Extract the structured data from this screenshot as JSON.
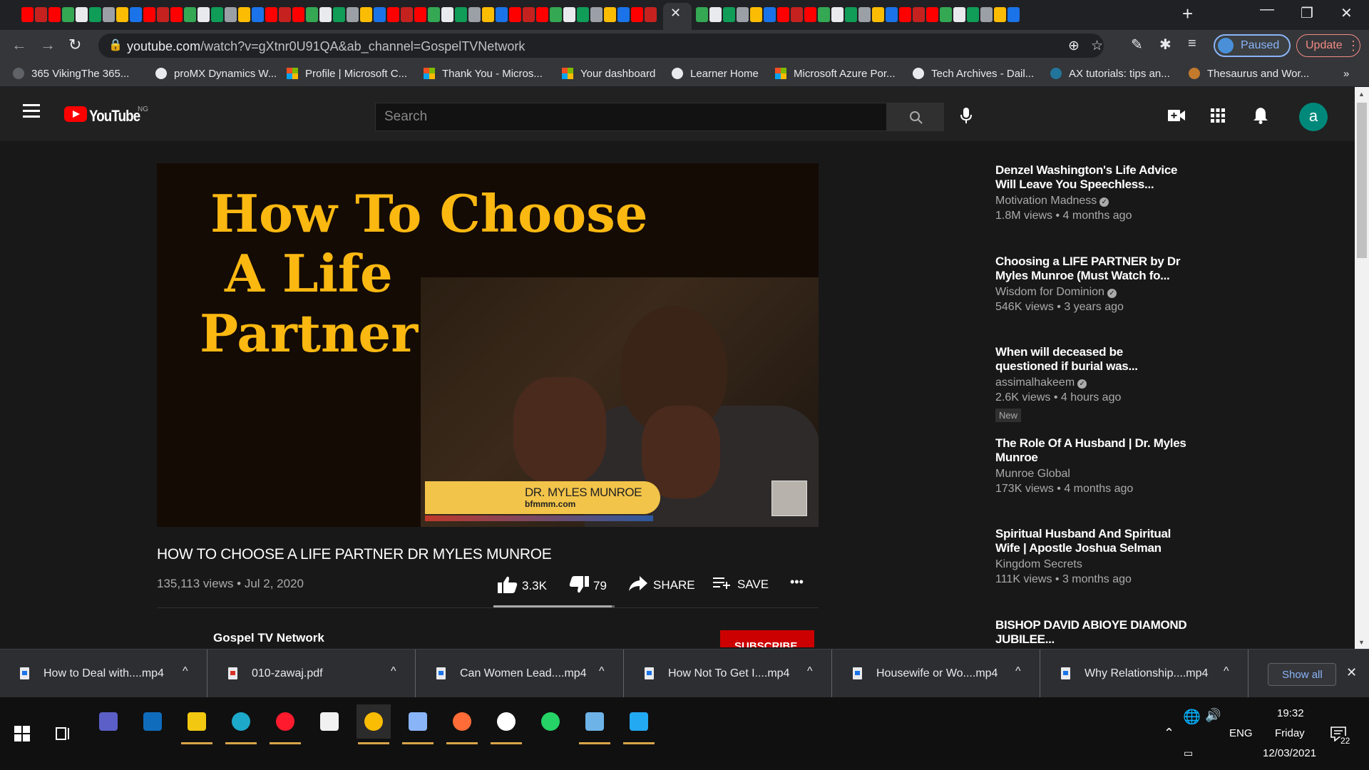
{
  "browser": {
    "window_controls": {
      "minimize": "—",
      "restore": "❐",
      "close": "✕"
    },
    "active_tab_close": "✕",
    "new_tab": "+",
    "url_host": "youtube.com",
    "url_path": "/watch?v=gXtnr0U91QA&ab_channel=GospelTVNetwork",
    "profile_status": "Paused",
    "update_label": "Update",
    "bookmarks": [
      {
        "label": "365 VikingThe 365...",
        "icon": "viking-icon"
      },
      {
        "label": "proMX Dynamics W...",
        "icon": "promx-icon"
      },
      {
        "label": "Profile | Microsoft C...",
        "icon": "microsoft-icon"
      },
      {
        "label": "Thank You - Micros...",
        "icon": "microsoft-icon"
      },
      {
        "label": "Your dashboard",
        "icon": "microsoft-icon"
      },
      {
        "label": "Learner Home",
        "icon": "globe-icon"
      },
      {
        "label": "Microsoft Azure Por...",
        "icon": "microsoft-icon"
      },
      {
        "label": "Tech Archives - Dail...",
        "icon": "globe-icon"
      },
      {
        "label": "AX tutorials: tips an...",
        "icon": "wordpress-icon"
      },
      {
        "label": "Thesaurus and Wor...",
        "icon": "thesaurus-icon"
      }
    ],
    "bookmarks_overflow": "»"
  },
  "youtube": {
    "logo_text": "YouTube",
    "country": "NG",
    "search_placeholder": "Search",
    "avatar_letter": "a"
  },
  "video": {
    "thumbnail": {
      "line1": "How To Choose",
      "line2": "A Life",
      "line3": "Partner",
      "lower_third_name": "DR. MYLES MUNROE",
      "lower_third_site": "bfmmm.com"
    },
    "title": "HOW TO CHOOSE A LIFE PARTNER DR MYLES MUNROE",
    "views": "135,113 views",
    "date": "Jul 2, 2020",
    "likes": "3.3K",
    "dislikes": "79",
    "like_ratio": 0.977,
    "share_label": "SHARE",
    "save_label": "SAVE",
    "more": "•••",
    "channel": "Gospel TV Network",
    "subscribe_label": "SUBSCRIBE"
  },
  "recommendations": [
    {
      "title": "Denzel Washington's Life Advice Will Leave You Speechless...",
      "channel": "Motivation Madness",
      "verified": true,
      "meta": "1.8M views • 4 months ago"
    },
    {
      "title": "Choosing a LIFE PARTNER by Dr Myles Munroe (Must Watch fo...",
      "channel": "Wisdom for Dominion",
      "verified": true,
      "meta": "546K views • 3 years ago"
    },
    {
      "title": "When will deceased be questioned if burial was...",
      "channel": "assimalhakeem",
      "verified": true,
      "meta": "2.6K views • 4 hours ago",
      "badge": "New"
    },
    {
      "title": "The Role Of A Husband | Dr. Myles Munroe",
      "channel": "Munroe Global",
      "verified": false,
      "meta": "173K views • 4 months ago"
    },
    {
      "title": "Spiritual Husband And Spiritual Wife | Apostle Joshua Selman",
      "channel": "Kingdom Secrets",
      "verified": false,
      "meta": "111K views • 3 months ago"
    },
    {
      "title": "BISHOP DAVID ABIOYE DIAMOND JUBILEE...",
      "channel": "",
      "verified": false,
      "meta": ""
    }
  ],
  "downloads": [
    {
      "name": "How to Deal with....mp4",
      "type": "video"
    },
    {
      "name": "010-zawaj.pdf",
      "type": "pdf"
    },
    {
      "name": "Can Women Lead....mp4",
      "type": "video"
    },
    {
      "name": "How Not To Get I....mp4",
      "type": "video"
    },
    {
      "name": "Housewife or Wo....mp4",
      "type": "video"
    },
    {
      "name": "Why Relationship....mp4",
      "type": "video"
    }
  ],
  "downloads_show_all": "Show all",
  "downloads_close": "✕",
  "downloads_caret": "^",
  "taskbar": {
    "apps": [
      "teams-icon",
      "outlook-icon",
      "file-explorer-icon",
      "edge-icon",
      "opera-icon",
      "notepad-icon",
      "chrome-icon",
      "remote-desktop-icon",
      "postman-icon",
      "vpn-icon",
      "whatsapp-icon",
      "notes-icon",
      "vscode-icon"
    ],
    "language": "ENG",
    "time": "19:32",
    "day": "Friday",
    "date": "12/03/2021",
    "notification_count": "22"
  }
}
